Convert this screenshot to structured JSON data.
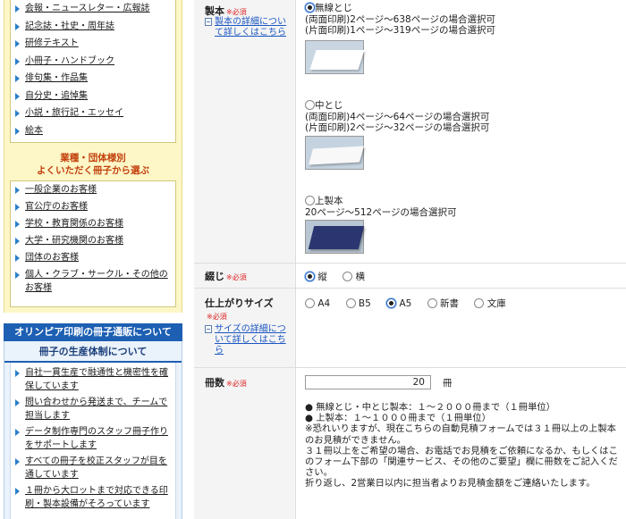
{
  "sidebar": {
    "top_items": [
      {
        "label": "会報・ニュースレター・広報誌"
      },
      {
        "label": "記念誌・社史・周年誌"
      },
      {
        "label": "研修テキスト"
      },
      {
        "label": "小冊子・ハンドブック"
      },
      {
        "label": "俳句集・作品集"
      },
      {
        "label": "自分史・追悼集"
      },
      {
        "label": "小説・旅行記・エッセイ"
      },
      {
        "label": "絵本"
      }
    ],
    "industry_title_line1": "業種・団体様別",
    "industry_title_line2": "よくいただく冊子から選ぶ",
    "industry_items": [
      {
        "label": "一般企業のお客様"
      },
      {
        "label": "官公庁のお客様"
      },
      {
        "label": "学校・教育関係のお客様"
      },
      {
        "label": "大学・研究機関のお客様"
      },
      {
        "label": "団体のお客様"
      },
      {
        "label": "個人・クラブ・サークル・その他のお客様"
      }
    ],
    "about_heading": "オリンピア印刷の冊子通販について",
    "production_heading": "冊子の生産体制について",
    "production_items": [
      {
        "label": "自社一貫生産で融通性と機密性を確保しています"
      },
      {
        "label": "問い合わせから発送まで、チームで担当します"
      },
      {
        "label": "データ制作専門のスタッフ冊子作りをサポートします"
      },
      {
        "label": "すべての冊子を校正スタッフが目を通しています"
      },
      {
        "label": "１冊から大ロットまで対応できる印刷・製本設備がそろっています"
      }
    ]
  },
  "form": {
    "required_mark": "※必須",
    "binding": {
      "label": "製本",
      "detail_link": "製本の詳細について詳しくはこちら",
      "options": [
        {
          "name": "無線とじ",
          "line1": "(両面印刷)2ページ〜638ページの場合選択可",
          "line2": "(片面印刷)1ページ〜319ページの場合選択可",
          "selected": true
        },
        {
          "name": "中とじ",
          "line1": "(両面印刷)4ページ〜64ページの場合選択可",
          "line2": "(片面印刷)2ページ〜32ページの場合選択可",
          "selected": false
        },
        {
          "name": "上製本",
          "line1": "20ページ〜512ページの場合選択可",
          "selected": false
        }
      ]
    },
    "orientation": {
      "label": "綴じ",
      "options": [
        {
          "name": "縦",
          "selected": true
        },
        {
          "name": "横",
          "selected": false
        }
      ]
    },
    "finish_size": {
      "label": "仕上がりサイズ",
      "detail_link": "サイズの詳細について詳しくはこちら",
      "options": [
        {
          "name": "A4",
          "selected": false
        },
        {
          "name": "B5",
          "selected": false
        },
        {
          "name": "A5",
          "selected": true
        },
        {
          "name": "新書",
          "selected": false
        },
        {
          "name": "文庫",
          "selected": false
        }
      ]
    },
    "quantity": {
      "label": "冊数",
      "value": "20",
      "unit": "冊",
      "notes": [
        "● 無線とじ・中とじ製本：１〜２０００冊まで（１冊単位）",
        "● 上製本：１〜１０００冊まで（１冊単位）",
        "※恐れいりますが、現在こちらの自動見積フォームでは３１冊以上の上製本のお見積ができません。",
        "３１冊以上をご希望の場合、お電話でお見積をご依頼になるか、もしくはこのフォーム下部の「関連サービス、その他のご要望」欄に冊数をご記入ください。",
        "折り返し、2営業日以内に担当者よりお見積金額をご連絡いたします。"
      ]
    }
  }
}
